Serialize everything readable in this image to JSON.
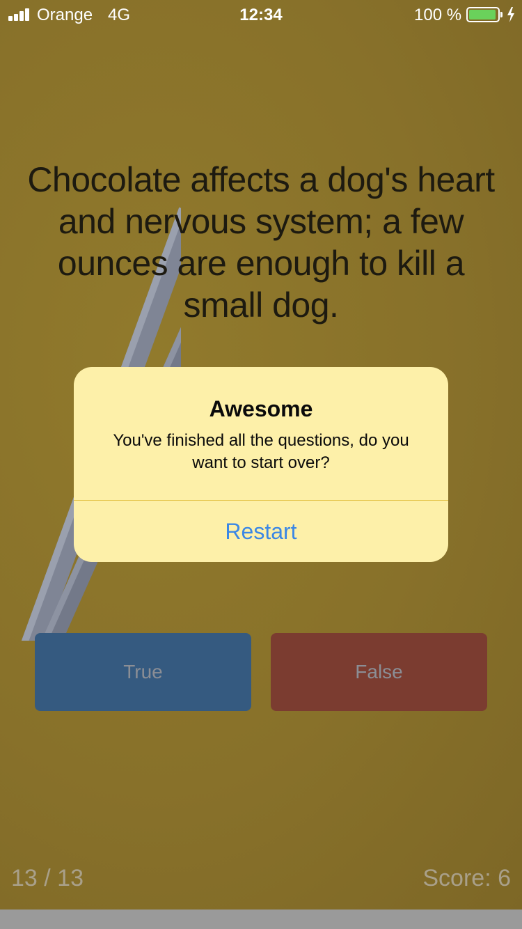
{
  "status_bar": {
    "carrier": "Orange",
    "network": "4G",
    "time": "12:34",
    "battery": "100 %",
    "battery_color": "#6ad15b"
  },
  "question": {
    "text": "Chocolate affects a dog's heart and nervous system; a few ounces are enough to kill a small dog."
  },
  "answers": {
    "true_label": "True",
    "false_label": "False",
    "true_color": "#355a80",
    "false_color": "#7b3c30"
  },
  "footer": {
    "progress": "13 / 13",
    "score": "Score: 6"
  },
  "alert": {
    "title": "Awesome",
    "message": "You've finished all the questions, do you want to start over?",
    "action_label": "Restart",
    "action_color": "#3a87e5"
  },
  "icons": [
    "signal-icon",
    "battery-icon",
    "charging-bolt-icon"
  ]
}
